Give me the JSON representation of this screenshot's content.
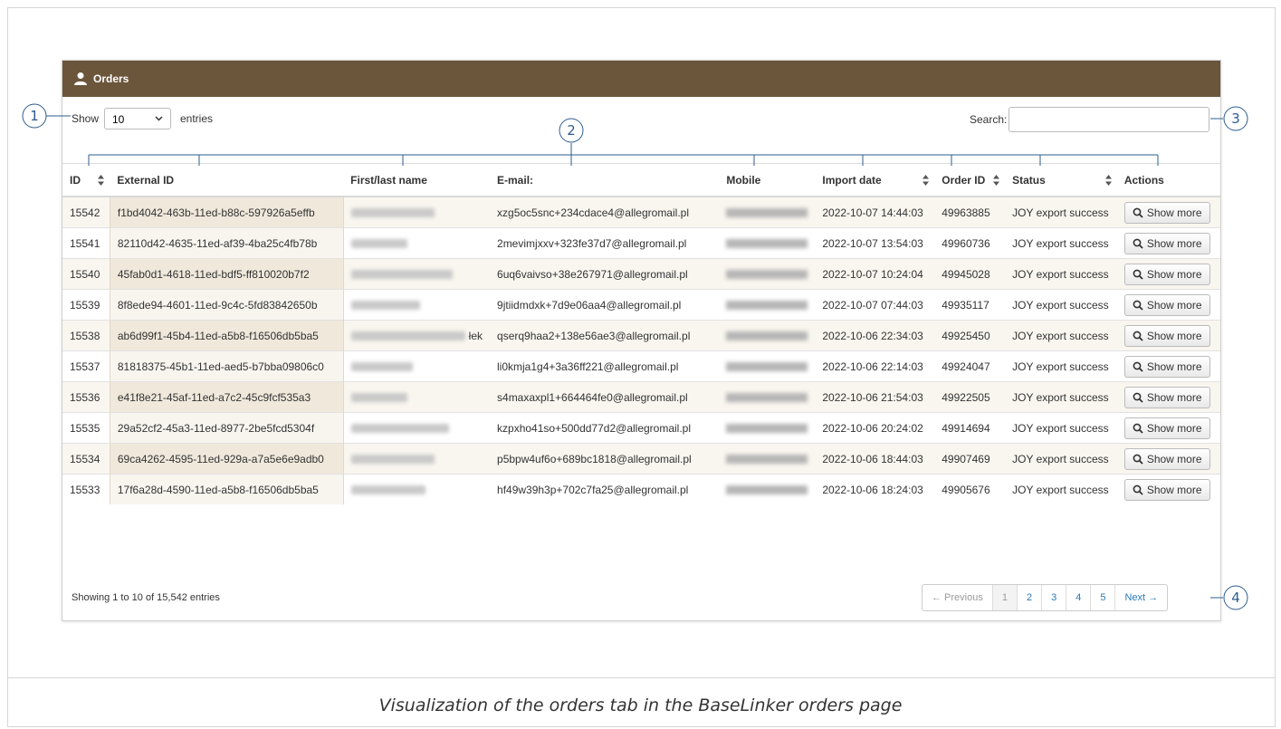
{
  "panel": {
    "title": "Orders"
  },
  "length_menu": {
    "prefix": "Show",
    "value": "10",
    "suffix": "entries"
  },
  "search": {
    "label": "Search:",
    "value": ""
  },
  "table": {
    "columns": [
      "ID",
      "External ID",
      "First/last name",
      "E-mail:",
      "Mobile",
      "Import date",
      "Order ID",
      "Status",
      "Actions"
    ],
    "rows": [
      {
        "id": "15542",
        "external_id": "f1bd4042-463b-11ed-b88c-597926a5effb",
        "name": "",
        "email": "xzg5oc5snc+234cdace4@allegromail.pl",
        "mobile": "",
        "import_date": "2022-10-07 14:44:03",
        "order_id": "49963885",
        "status": "JOY export success",
        "action": "Show more"
      },
      {
        "id": "15541",
        "external_id": "82110d42-4635-11ed-af39-4ba25c4fb78b",
        "name": "",
        "email": "2mevimjxxv+323fe37d7@allegromail.pl",
        "mobile": "",
        "import_date": "2022-10-07 13:54:03",
        "order_id": "49960736",
        "status": "JOY export success",
        "action": "Show more"
      },
      {
        "id": "15540",
        "external_id": "45fab0d1-4618-11ed-bdf5-ff810020b7f2",
        "name": "",
        "email": "6uq6vaivso+38e267971@allegromail.pl",
        "mobile": "",
        "import_date": "2022-10-07 10:24:04",
        "order_id": "49945028",
        "status": "JOY export success",
        "action": "Show more"
      },
      {
        "id": "15539",
        "external_id": "8f8ede94-4601-11ed-9c4c-5fd83842650b",
        "name": "",
        "email": "9jtiidmdxk+7d9e06aa4@allegromail.pl",
        "mobile": "",
        "import_date": "2022-10-07 07:44:03",
        "order_id": "49935117",
        "status": "JOY export success",
        "action": "Show more"
      },
      {
        "id": "15538",
        "external_id": "ab6d99f1-45b4-11ed-a5b8-f16506db5ba5",
        "name": "łek",
        "email": "qserq9haa2+138e56ae3@allegromail.pl",
        "mobile": "",
        "import_date": "2022-10-06 22:34:03",
        "order_id": "49925450",
        "status": "JOY export success",
        "action": "Show more"
      },
      {
        "id": "15537",
        "external_id": "81818375-45b1-11ed-aed5-b7bba09806c0",
        "name": "",
        "email": "li0kmja1g4+3a36ff221@allegromail.pl",
        "mobile": "",
        "import_date": "2022-10-06 22:14:03",
        "order_id": "49924047",
        "status": "JOY export success",
        "action": "Show more"
      },
      {
        "id": "15536",
        "external_id": "e41f8e21-45af-11ed-a7c2-45c9fcf535a3",
        "name": "",
        "email": "s4maxaxpl1+664464fe0@allegromail.pl",
        "mobile": "",
        "import_date": "2022-10-06 21:54:03",
        "order_id": "49922505",
        "status": "JOY export success",
        "action": "Show more"
      },
      {
        "id": "15535",
        "external_id": "29a52cf2-45a3-11ed-8977-2be5fcd5304f",
        "name": "",
        "email": "kzpxho41so+500dd77d2@allegromail.pl",
        "mobile": "",
        "import_date": "2022-10-06 20:24:02",
        "order_id": "49914694",
        "status": "JOY export success",
        "action": "Show more"
      },
      {
        "id": "15534",
        "external_id": "69ca4262-4595-11ed-929a-a7a5e6e9adb0",
        "name": "",
        "email": "p5bpw4uf6o+689bc1818@allegromail.pl",
        "mobile": "",
        "import_date": "2022-10-06 18:44:03",
        "order_id": "49907469",
        "status": "JOY export success",
        "action": "Show more"
      },
      {
        "id": "15533",
        "external_id": "17f6a28d-4590-11ed-a5b8-f16506db5ba5",
        "name": "",
        "email": "hf49w39h3p+702c7fa25@allegromail.pl",
        "mobile": "",
        "import_date": "2022-10-06 18:24:03",
        "order_id": "49905676",
        "status": "JOY export success",
        "action": "Show more"
      }
    ]
  },
  "info": "Showing 1 to 10 of 15,542 entries",
  "pagination": {
    "previous": "← Previous",
    "pages": [
      "1",
      "2",
      "3",
      "4",
      "5"
    ],
    "active_page": "1",
    "next": "Next →"
  },
  "annotations": [
    "1",
    "2",
    "3",
    "4"
  ],
  "caption": "Visualization of the orders tab in the BaseLinker orders page",
  "colors": {
    "header_bg": "#6b563b",
    "link": "#2a7ab8",
    "annotation": "#2e5d8f"
  },
  "icons": {
    "panel": "user-icon",
    "button": "search-icon",
    "select": "chevron-down-icon",
    "sort": "sort-icon"
  }
}
